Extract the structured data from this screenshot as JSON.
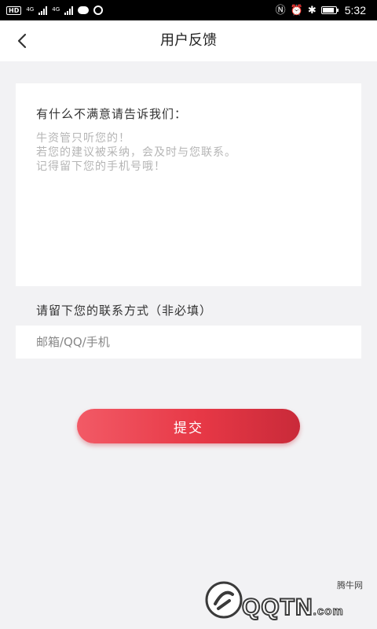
{
  "status_bar": {
    "left_badge": "HD",
    "net_1": "4G",
    "net_2": "4G",
    "time": "5:32",
    "nfc_icon": "nfc-icon",
    "battery_level": 0.85
  },
  "header": {
    "back_icon": "chevron-left-icon",
    "title": "用户反馈"
  },
  "feedback": {
    "prompt": "有什么不满意请告诉我们：",
    "placeholder": "牛资管只听您的！\n若您的建议被采纳，会及时与您联系。\n记得留下您的手机号哦！",
    "value": ""
  },
  "contact": {
    "label": "请留下您的联系方式（非必填）",
    "placeholder": "邮箱/QQ/手机",
    "value": ""
  },
  "submit": {
    "label": "提交"
  },
  "colors": {
    "accent": "#e73846",
    "background": "#f2f2f4"
  },
  "watermark": {
    "brand": "QQTN",
    "suffix": ".com",
    "sub": "腾牛网"
  }
}
